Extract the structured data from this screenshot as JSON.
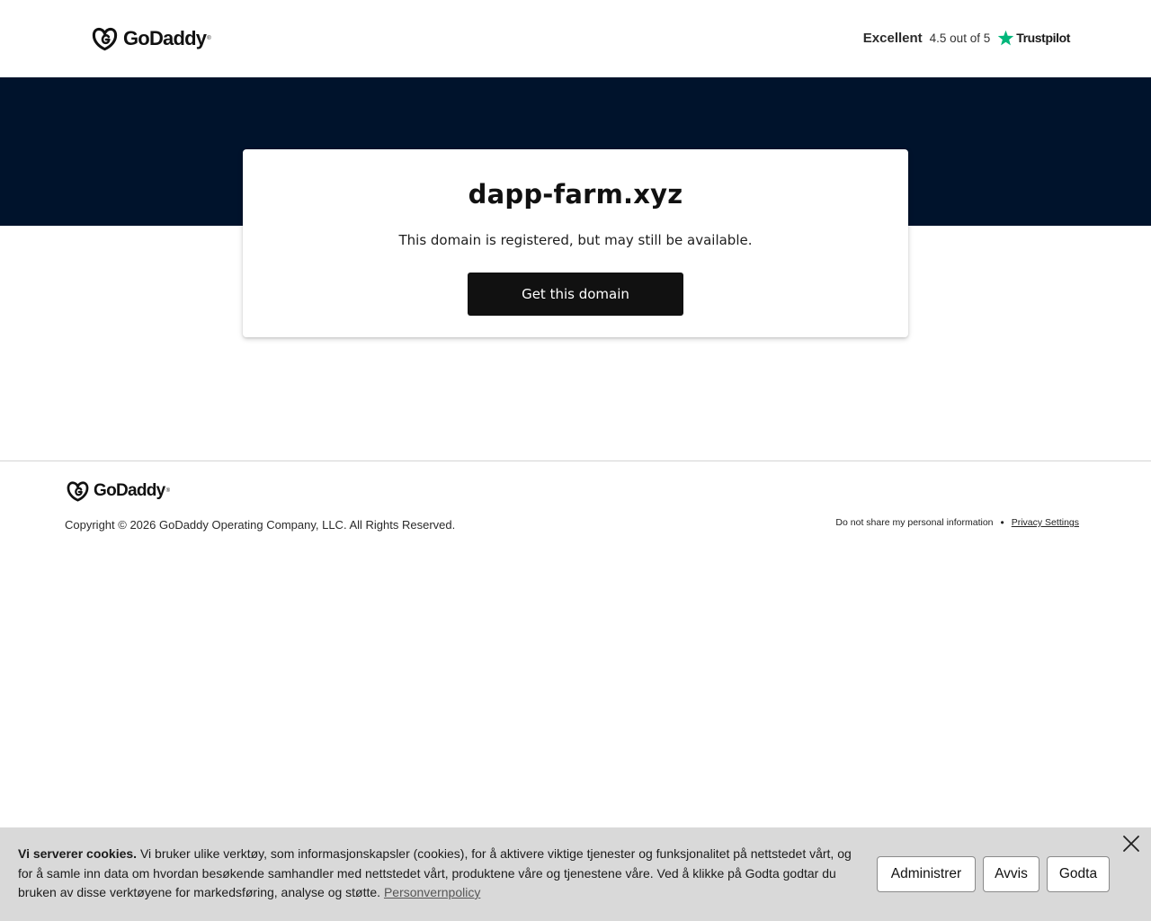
{
  "header": {
    "brand": "GoDaddy",
    "brand_mark": "®",
    "rating_label": "Excellent",
    "rating_score": "4.5 out of 5",
    "review_brand": "Trustpilot"
  },
  "main": {
    "domain": "dapp-farm.xyz",
    "status": "This domain is registered, but may still be available.",
    "cta_label": "Get this domain"
  },
  "footer": {
    "brand": "GoDaddy",
    "copyright": "Copyright © 2026 GoDaddy Operating Company, LLC. All Rights Reserved.",
    "do_not_share": "Do not share my personal information",
    "separator": "•",
    "privacy_settings": "Privacy Settings"
  },
  "cookie_banner": {
    "heading": "Vi serverer cookies.",
    "body": " Vi bruker ulike verktøy, som informasjonskapsler (cookies), for å aktivere viktige tjenester og funksjonalitet på nettstedet vårt, og for å samle inn data om hvordan besøkende samhandler med nettstedet vårt, produktene våre og tjenestene våre. Ved å klikke på Godta godtar du bruken av disse verktøyene for markedsføring, analyse og støtte. ",
    "policy_link": "Personvernpolicy",
    "manage_label": "Administrer",
    "reject_label": "Avvis",
    "accept_label": "Godta"
  },
  "icons": {
    "logo": "godaddy-logo-icon",
    "star": "trustpilot-star-icon",
    "close": "close-icon"
  },
  "colors": {
    "hero": "#00132c",
    "button": "#111111",
    "trustpilot_star": "#00b67a",
    "banner": "#d9d9d9"
  }
}
